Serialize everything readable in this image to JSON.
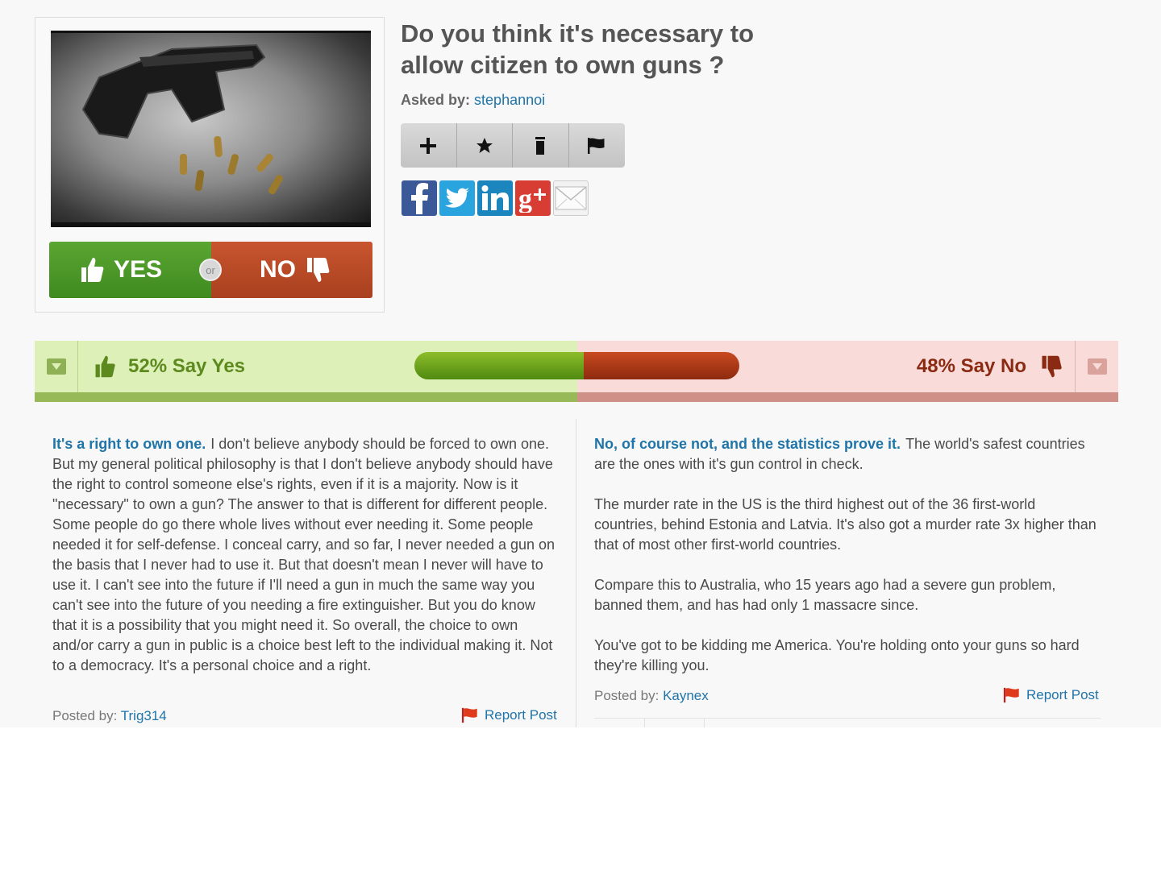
{
  "question": {
    "title": "Do you think it's necessary to allow citizen to own guns ?",
    "asked_by_label": "Asked by:",
    "asked_by_user": "stephannoi",
    "image_icon": "handgun-with-bullets-image"
  },
  "vote": {
    "yes_label": "YES",
    "no_label": "NO",
    "or_label": "or"
  },
  "actions": [
    {
      "icon": "plus-icon"
    },
    {
      "icon": "star-icon"
    },
    {
      "icon": "trash-icon"
    },
    {
      "icon": "flag-icon"
    }
  ],
  "share": [
    "facebook-icon",
    "twitter-icon",
    "linkedin-icon",
    "google-plus-icon",
    "email-icon"
  ],
  "results": {
    "yes_percent": 52,
    "no_percent": 48,
    "yes_text": "52% Say Yes",
    "no_text": "48% Say No"
  },
  "arguments": {
    "yes": {
      "lead": "It's a right to own one.",
      "body": "I don't believe anybody should be forced to own one. But my general political philosophy is that I don't believe anybody should have the right to control someone else's rights, even if it is a majority. Now is it \"necessary\" to own a gun? The answer to that is different for different people. Some people do go there whole lives without ever needing it. Some people needed it for self-defense. I conceal carry, and so far, I never needed a gun on the basis that I never had to use it. But that doesn't mean I never will have to use it. I can't see into the future if I'll need a gun in much the same way you can't see into the future of you needing a fire extinguisher. But you do know that it is a possibility that you might need it. So overall, the choice to own and/or carry a gun in public is a choice best left to the individual making it. Not to a democracy. It's a personal choice and a right.",
      "posted_by_label": "Posted by:",
      "posted_by_user": "Trig314",
      "report_label": "Report Post"
    },
    "no": {
      "lead": "No, of course not, and the statistics prove it.",
      "paragraph1": "The world's safest countries are the ones with it's gun control in check.",
      "paragraph2": "The murder rate in the US is the third highest out of the 36 first-world countries, behind Estonia and Latvia. It's also got a murder rate 3x higher than that of most other first-world countries.",
      "paragraph3": "Compare this to Australia, who 15 years ago had a severe gun problem, banned them, and has had only 1 massacre since.",
      "paragraph4": "You've got to be kidding me America. You're holding onto your guns so hard they're killing you.",
      "posted_by_label": "Posted by:",
      "posted_by_user": "Kaynex",
      "report_label": "Report Post"
    }
  },
  "colors": {
    "yes_green": "#4f9a26",
    "no_red": "#b7482a",
    "link_blue": "#1f74a8"
  }
}
